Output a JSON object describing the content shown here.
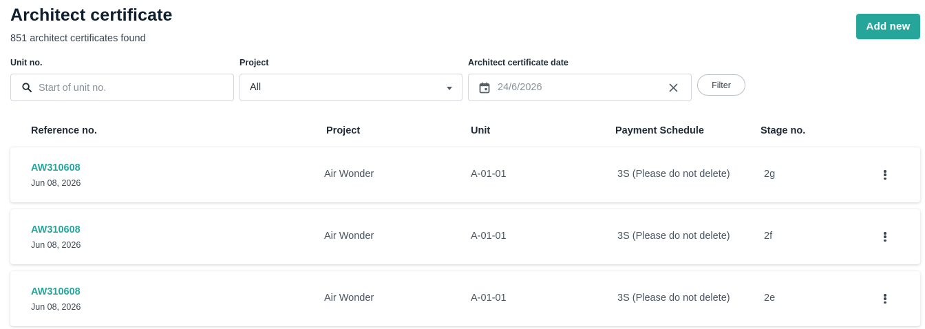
{
  "header": {
    "title": "Architect certificate",
    "count_text": "851 architect certificates found",
    "add_new_label": "Add new"
  },
  "filters": {
    "unit": {
      "label": "Unit no.",
      "placeholder": "Start of unit no.",
      "value": ""
    },
    "project": {
      "label": "Project",
      "value": "All"
    },
    "date": {
      "label": "Architect certificate date",
      "value": "24/6/2026"
    },
    "filter_label": "Filter"
  },
  "table": {
    "columns": [
      "Reference no.",
      "Project",
      "Unit",
      "Payment Schedule",
      "Stage no."
    ],
    "rows": [
      {
        "ref": "AW310608",
        "date": "Jun 08, 2026",
        "project": "Air Wonder",
        "unit": "A-01-01",
        "schedule": "3S (Please do not delete)",
        "stage": "2g"
      },
      {
        "ref": "AW310608",
        "date": "Jun 08, 2026",
        "project": "Air Wonder",
        "unit": "A-01-01",
        "schedule": "3S (Please do not delete)",
        "stage": "2f"
      },
      {
        "ref": "AW310608",
        "date": "Jun 08, 2026",
        "project": "Air Wonder",
        "unit": "A-01-01",
        "schedule": "3S (Please do not delete)",
        "stage": "2e"
      }
    ]
  },
  "colors": {
    "accent": "#26a69a",
    "text": "#1f2a36",
    "border": "#d3d7dc"
  },
  "icons": [
    "search-icon",
    "chevron-down-icon",
    "calendar-icon",
    "close-icon",
    "more-vert-icon"
  ]
}
